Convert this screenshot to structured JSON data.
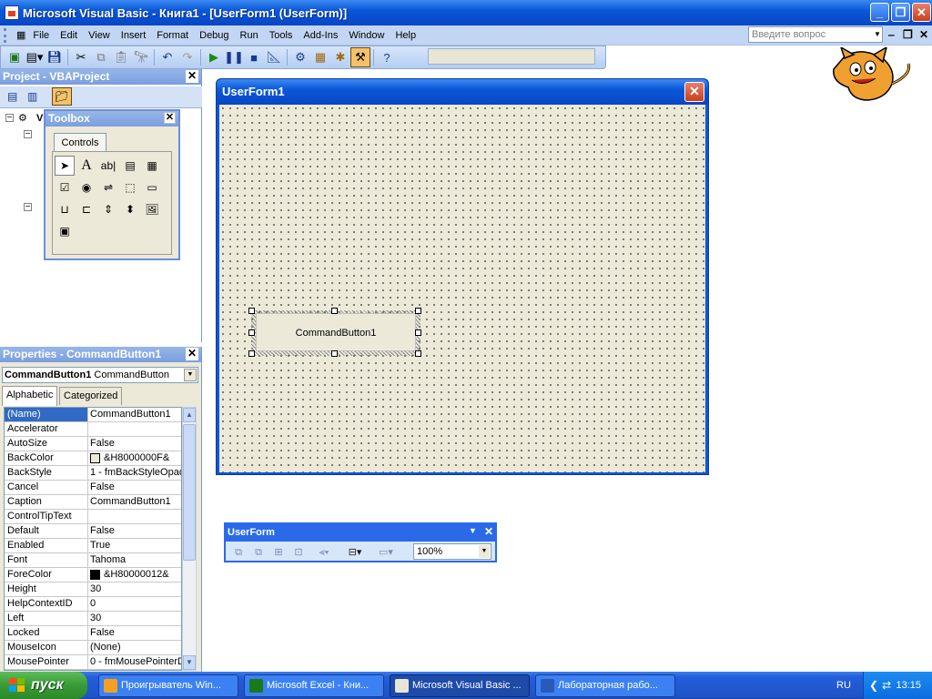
{
  "window": {
    "title": "Microsoft Visual Basic - Книга1 - [UserForm1 (UserForm)]"
  },
  "menu": {
    "items": [
      "File",
      "Edit",
      "View",
      "Insert",
      "Format",
      "Debug",
      "Run",
      "Tools",
      "Add-Ins",
      "Window",
      "Help"
    ],
    "help_placeholder": "Введите вопрос"
  },
  "project": {
    "title": "Project - VBAProject",
    "root_label": "V"
  },
  "toolbox": {
    "title": "Toolbox",
    "tab": "Controls"
  },
  "properties": {
    "title": "Properties - CommandButton1",
    "object_name": "CommandButton1",
    "object_type": "CommandButton",
    "tabs": [
      "Alphabetic",
      "Categorized"
    ],
    "rows": [
      {
        "name": "(Name)",
        "value": "CommandButton1"
      },
      {
        "name": "Accelerator",
        "value": ""
      },
      {
        "name": "AutoSize",
        "value": "False"
      },
      {
        "name": "BackColor",
        "value": "&H8000000F&",
        "swatch": "#ece9d8"
      },
      {
        "name": "BackStyle",
        "value": "1 - fmBackStyleOpaq"
      },
      {
        "name": "Cancel",
        "value": "False"
      },
      {
        "name": "Caption",
        "value": "CommandButton1"
      },
      {
        "name": "ControlTipText",
        "value": ""
      },
      {
        "name": "Default",
        "value": "False"
      },
      {
        "name": "Enabled",
        "value": "True"
      },
      {
        "name": "Font",
        "value": "Tahoma"
      },
      {
        "name": "ForeColor",
        "value": "&H80000012&",
        "swatch": "#000000"
      },
      {
        "name": "Height",
        "value": "30"
      },
      {
        "name": "HelpContextID",
        "value": "0"
      },
      {
        "name": "Left",
        "value": "30"
      },
      {
        "name": "Locked",
        "value": "False"
      },
      {
        "name": "MouseIcon",
        "value": "(None)"
      },
      {
        "name": "MousePointer",
        "value": "0 - fmMousePointerD"
      }
    ]
  },
  "userform": {
    "title": "UserForm1",
    "button_caption": "CommandButton1"
  },
  "userform_toolbar": {
    "title": "UserForm",
    "zoom": "100%"
  },
  "taskbar": {
    "start": "пуск",
    "tasks": [
      "Проигрыватель Win...",
      "Microsoft Excel - Кни...",
      "Microsoft Visual Basic ...",
      "Лабораторная рабо..."
    ],
    "lang": "RU",
    "clock": "13:15"
  },
  "colors": {
    "accent": "#0a58d8",
    "selection": "#316ac5",
    "form_bg": "#ece9d8"
  }
}
